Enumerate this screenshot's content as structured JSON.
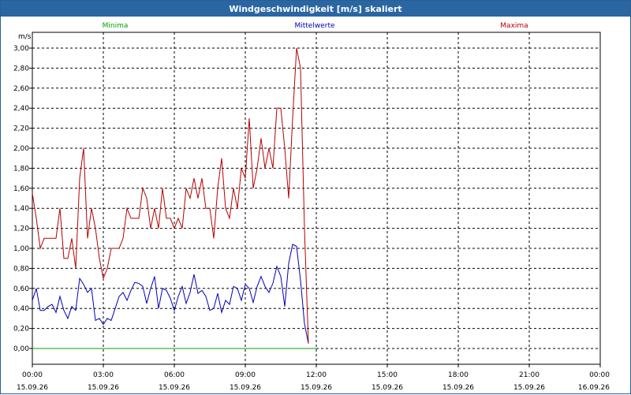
{
  "window": {
    "title": "Windgeschwindigkeit [m/s] skaliert"
  },
  "colors": {
    "minima": "#00a000",
    "mean": "#0000b4",
    "maxima": "#b40000",
    "grid": "#000000",
    "titlebar": "#2a66a2"
  },
  "chart_data": {
    "type": "line",
    "title": "Windgeschwindigkeit [m/s] skaliert",
    "ylabel": "m/s",
    "ylim": [
      0,
      3.0
    ],
    "xlim": [
      "2026-09-15T00:00",
      "2026-09-16T00:00"
    ],
    "x_ticks": [
      {
        "time": "00:00",
        "date": "15.09.26"
      },
      {
        "time": "03:00",
        "date": "15.09.26"
      },
      {
        "time": "06:00",
        "date": "15.09.26"
      },
      {
        "time": "09:00",
        "date": "15.09.26"
      },
      {
        "time": "12:00",
        "date": "15.09.26"
      },
      {
        "time": "15:00",
        "date": "15.09.26"
      },
      {
        "time": "18:00",
        "date": "15.09.26"
      },
      {
        "time": "21:00",
        "date": "15.09.26"
      },
      {
        "time": "00:00",
        "date": "16.09.26"
      }
    ],
    "y_ticks": [
      "0,00",
      "0,20",
      "0,40",
      "0,60",
      "0,80",
      "1,00",
      "1,20",
      "1,40",
      "1,60",
      "1,80",
      "2,00",
      "2,20",
      "2,40",
      "2,60",
      "2,80",
      "3,00"
    ],
    "grid": true,
    "legend": [
      "Minima",
      "Mittelwerte",
      "Maxima"
    ],
    "x": [
      "00:00",
      "00:10",
      "00:20",
      "00:30",
      "00:40",
      "00:50",
      "01:00",
      "01:10",
      "01:20",
      "01:30",
      "01:40",
      "01:50",
      "02:00",
      "02:10",
      "02:20",
      "02:30",
      "02:40",
      "02:50",
      "03:00",
      "03:10",
      "03:20",
      "03:30",
      "03:40",
      "03:50",
      "04:00",
      "04:10",
      "04:20",
      "04:30",
      "04:40",
      "04:50",
      "05:00",
      "05:10",
      "05:20",
      "05:30",
      "05:40",
      "05:50",
      "06:00",
      "06:10",
      "06:20",
      "06:30",
      "06:40",
      "06:50",
      "07:00",
      "07:10",
      "07:20",
      "07:30",
      "07:40",
      "07:50",
      "08:00",
      "08:10",
      "08:20",
      "08:30",
      "08:40",
      "08:50",
      "09:00",
      "09:10",
      "09:20",
      "09:30",
      "09:40",
      "09:50",
      "10:00",
      "10:10",
      "10:20",
      "10:30",
      "10:40",
      "10:50",
      "11:00",
      "11:10",
      "11:20",
      "11:30",
      "11:40",
      "11:50",
      "12:00"
    ],
    "series": [
      {
        "name": "Minima",
        "values": [
          0,
          0,
          0,
          0,
          0,
          0,
          0,
          0,
          0,
          0,
          0,
          0,
          0,
          0,
          0,
          0,
          0,
          0,
          0,
          0,
          0,
          0,
          0,
          0,
          0,
          0,
          0,
          0,
          0,
          0,
          0,
          0,
          0,
          0,
          0,
          0,
          0,
          0,
          0,
          0,
          0,
          0,
          0,
          0,
          0,
          0,
          0,
          0,
          0,
          0,
          0,
          0,
          0,
          0,
          0,
          0,
          0,
          0,
          0,
          0,
          0,
          0,
          0,
          0,
          0,
          0,
          0,
          0,
          0,
          0,
          0,
          0,
          0
        ]
      },
      {
        "name": "Mittelwerte",
        "values": [
          0.48,
          0.6,
          0.38,
          0.38,
          0.42,
          0.44,
          0.36,
          0.52,
          0.38,
          0.3,
          0.42,
          0.38,
          0.7,
          0.64,
          0.56,
          0.6,
          0.28,
          0.3,
          0.24,
          0.3,
          0.28,
          0.4,
          0.52,
          0.56,
          0.48,
          0.58,
          0.66,
          0.65,
          0.62,
          0.45,
          0.6,
          0.72,
          0.4,
          0.6,
          0.58,
          0.5,
          0.38,
          0.52,
          0.62,
          0.45,
          0.56,
          0.74,
          0.55,
          0.58,
          0.52,
          0.38,
          0.4,
          0.55,
          0.36,
          0.48,
          0.44,
          0.62,
          0.6,
          0.48,
          0.64,
          0.6,
          0.46,
          0.62,
          0.72,
          0.62,
          0.56,
          0.65,
          0.82,
          0.72,
          0.42,
          0.85,
          1.04,
          1.02,
          0.68,
          0.25,
          0.05
        ]
      },
      {
        "name": "Maxima",
        "values": [
          1.55,
          1.3,
          1.0,
          1.1,
          1.1,
          1.1,
          1.1,
          1.4,
          0.9,
          0.9,
          1.1,
          0.8,
          1.7,
          2.0,
          1.1,
          1.4,
          1.2,
          0.9,
          0.7,
          0.8,
          1.0,
          1.0,
          1.0,
          1.1,
          1.4,
          1.3,
          1.3,
          1.3,
          1.6,
          1.5,
          1.2,
          1.4,
          1.2,
          1.6,
          1.3,
          1.3,
          1.2,
          1.3,
          1.2,
          1.6,
          1.5,
          1.7,
          1.5,
          1.7,
          1.4,
          1.4,
          1.1,
          1.6,
          1.9,
          1.4,
          1.3,
          1.6,
          1.4,
          1.8,
          1.7,
          2.3,
          1.6,
          1.8,
          2.1,
          1.8,
          2.0,
          1.8,
          2.4,
          2.4,
          2.0,
          1.5,
          2.3,
          3.0,
          2.8,
          1.2,
          0.05
        ]
      }
    ]
  }
}
